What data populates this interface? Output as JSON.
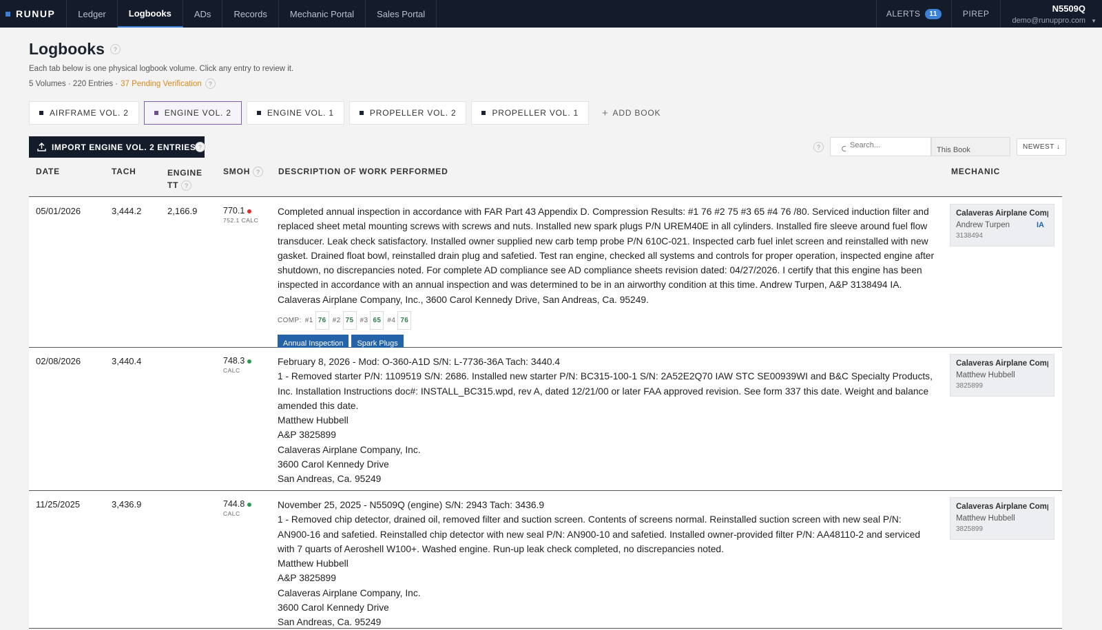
{
  "nav": {
    "brand": "RUNUP",
    "items": [
      "Ledger",
      "Logbooks",
      "ADs",
      "Records",
      "Mechanic Portal",
      "Sales Portal"
    ],
    "alerts_label": "ALERTS",
    "alerts_count": "11",
    "pirep_label": "PIREP",
    "tail_number": "N5509Q",
    "email": "demo@runuppro.com"
  },
  "header": {
    "title": "Logbooks",
    "subtitle": "Each tab below is one physical logbook volume. Click any entry to review it.",
    "stats": "5 Volumes · 220 Entries ·",
    "pending": "37 Pending Verification"
  },
  "tabs": [
    {
      "label": "AIRFRAME VOL. 2"
    },
    {
      "label": "ENGINE VOL. 2"
    },
    {
      "label": "ENGINE VOL. 1"
    },
    {
      "label": "PROPELLER VOL. 2"
    },
    {
      "label": "PROPELLER VOL. 1"
    }
  ],
  "add_book_label": "ADD BOOK",
  "toolbar": {
    "import_label": "IMPORT ENGINE VOL. 2 ENTRIES",
    "search_placeholder": "Search...",
    "scope": "This Book",
    "sort": "NEWEST ↓"
  },
  "columns": {
    "date": "DATE",
    "tach": "TACH",
    "engine_tt": "ENGINE TT",
    "smoh": "SMOH",
    "description": "DESCRIPTION OF WORK PERFORMED",
    "mechanic": "MECHANIC"
  },
  "entries": [
    {
      "date": "05/01/2026",
      "tach": "3,444.2",
      "engine_tt": "2,166.9",
      "smoh": "770.1",
      "smoh_sub": "752.1 CALC",
      "description": "Completed annual inspection in accordance with FAR Part 43 Appendix D. Compression Results: #1 76 #2 75 #3 65 #4 76 /80. Serviced induction filter and replaced sheet metal mounting screws with screws and nuts. Installed new spark plugs P/N UREM40E in all cylinders. Installed fire sleeve around fuel flow transducer. Leak check satisfactory. Installed owner supplied new carb temp probe P/N 610C-021. Inspected carb fuel inlet screen and reinstalled with new gasket. Drained float bowl, reinstalled drain plug and safetied. Test ran engine, checked all systems and controls for proper operation, inspected engine after shutdown, no discrepancies noted. For complete AD compliance see AD compliance sheets revision dated: 04/27/2026. I certify that this engine has been inspected in accordance with an annual inspection and was determined to be in an airworthy condition at this time. Andrew Turpen, A&P 3138494 IA. Calaveras Airplane Company, Inc., 3600 Carol Kennedy Drive, San Andreas, Ca. 95249.",
      "comp_label": "COMP:",
      "compression": [
        {
          "cyl": "#1",
          "val": "76"
        },
        {
          "cyl": "#2",
          "val": "75"
        },
        {
          "cyl": "#3",
          "val": "65"
        },
        {
          "cyl": "#4",
          "val": "76"
        }
      ],
      "tags": [
        "Annual Inspection",
        "Spark Plugs"
      ],
      "mechanic_company": "Calaveras Airplane Company, Inc.",
      "mechanic_name": "Andrew Turpen",
      "mechanic_cert": "3138494",
      "mechanic_badge": "IA"
    },
    {
      "date": "02/08/2026",
      "tach": "3,440.4",
      "engine_tt": "",
      "smoh": "748.3",
      "smoh_sub": "CALC",
      "description_lines": [
        "February 8, 2026 - Mod: O-360-A1D S/N: L-7736-36A Tach: 3440.4",
        "1 - Removed starter P/N: 1109519 S/N: 2686. Installed new starter P/N: BC315-100-1 S/N: 2A52E2Q70 IAW STC SE00939WI and B&C Specialty Products, Inc. Installation Instructions doc#: INSTALL_BC315.wpd, rev A, dated 12/21/00 or later FAA approved revision. See form 337 this date. Weight and balance amended this date.",
        "Matthew Hubbell",
        "A&P 3825899",
        "Calaveras Airplane Company, Inc.",
        "3600 Carol Kennedy Drive",
        "San Andreas, Ca. 95249"
      ],
      "mechanic_company": "Calaveras Airplane Company, Inc.",
      "mechanic_name": "Matthew Hubbell",
      "mechanic_cert": "3825899"
    },
    {
      "date": "11/25/2025",
      "tach": "3,436.9",
      "engine_tt": "",
      "smoh": "744.8",
      "smoh_sub": "CALC",
      "description_lines": [
        "November 25, 2025 - N5509Q (engine) S/N: 2943 Tach: 3436.9",
        "1 - Removed chip detector, drained oil, removed filter and suction screen. Contents of screens normal. Reinstalled suction screen with new seal P/N: AN900-16 and safetied. Reinstalled chip detector with new seal P/N: AN900-10 and safetied. Installed owner-provided filter P/N: AA48110-2 and serviced with 7 quarts of Aeroshell W100+. Washed engine. Run-up leak check completed, no discrepancies noted.",
        "Matthew Hubbell",
        "A&P 3825899",
        "Calaveras Airplane Company, Inc.",
        "3600 Carol Kennedy Drive",
        "San Andreas, Ca. 95249"
      ],
      "mechanic_company": "Calaveras Airplane Company, Inc.",
      "mechanic_name": "Matthew Hubbell",
      "mechanic_cert": "3825899"
    }
  ]
}
